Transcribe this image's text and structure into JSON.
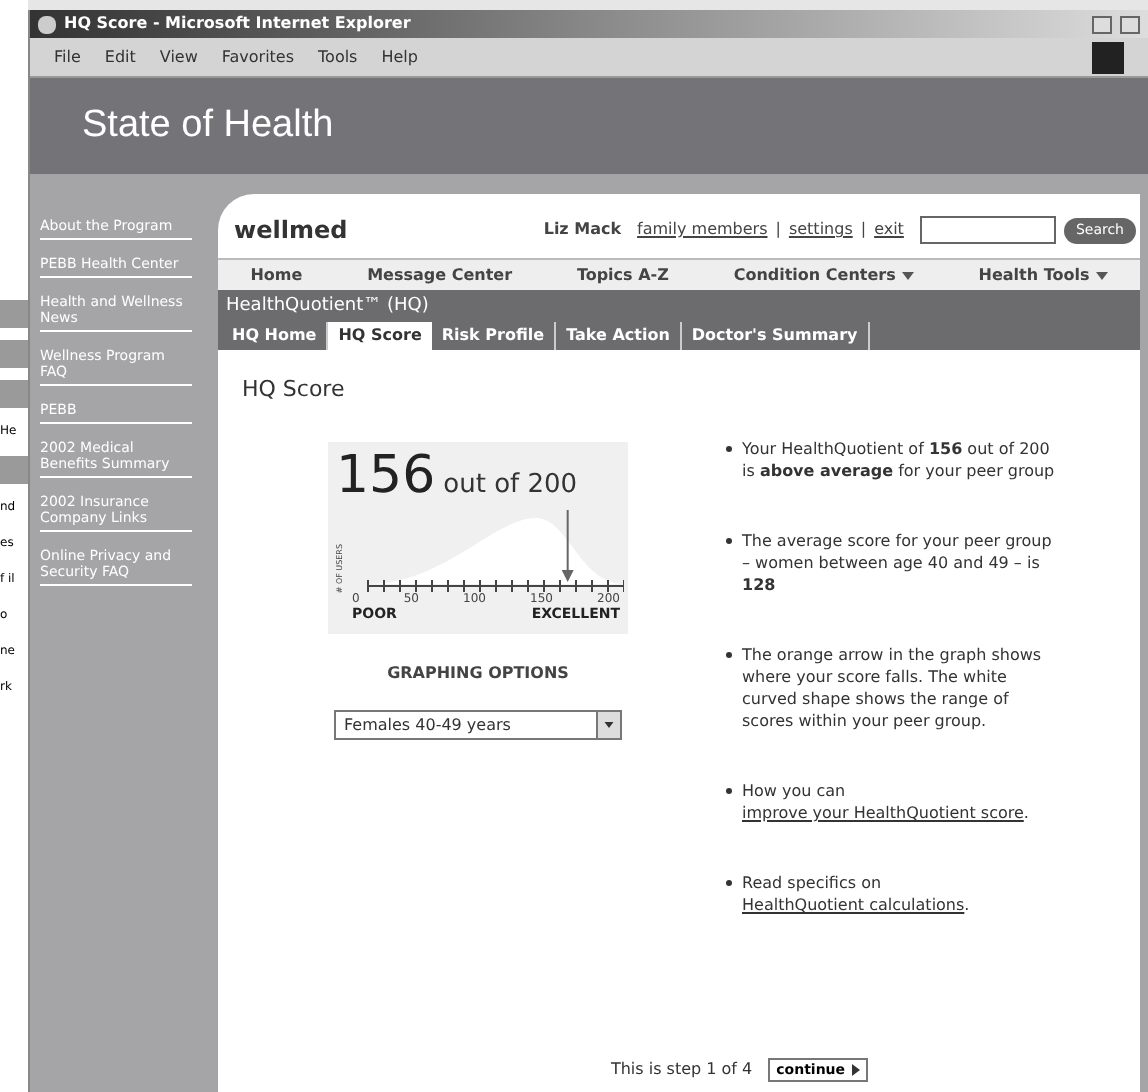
{
  "background_window": {
    "fragments": [
      {
        "kind": "bar"
      },
      {
        "kind": "bar"
      },
      {
        "kind": "bar"
      },
      {
        "kind": "text",
        "text": "He"
      },
      {
        "kind": "bar"
      },
      {
        "kind": "text",
        "text": "nd"
      },
      {
        "kind": "text",
        "text": "es"
      },
      {
        "kind": "text",
        "text": "f il"
      },
      {
        "kind": "text",
        "text": "o"
      },
      {
        "kind": "text",
        "text": "ne"
      },
      {
        "kind": "text",
        "text": "rk"
      }
    ]
  },
  "window": {
    "title": "HQ Score - Microsoft Internet Explorer"
  },
  "menu_bar": [
    "File",
    "Edit",
    "View",
    "Favorites",
    "Tools",
    "Help"
  ],
  "header": {
    "title": "State of Health"
  },
  "sidebar": {
    "items": [
      {
        "label": "About the Program"
      },
      {
        "label": "PEBB Health Center"
      },
      {
        "label": "Health and Wellness News"
      },
      {
        "label": "Wellness Program FAQ"
      },
      {
        "label": "PEBB"
      },
      {
        "label": "2002 Medical Benefits Summary"
      },
      {
        "label": "2002 Insurance Company Links"
      },
      {
        "label": "Online Privacy and Security FAQ"
      }
    ]
  },
  "top_bar": {
    "logo": "wellmed",
    "user": "Liz Mack",
    "links": [
      "family members",
      "settings",
      "exit"
    ],
    "separator": "|",
    "search_button": "Search"
  },
  "nav": [
    {
      "label": "Home",
      "dropdown": false
    },
    {
      "label": "Message Center",
      "dropdown": false
    },
    {
      "label": "Topics A-Z",
      "dropdown": false
    },
    {
      "label": "Condition Centers",
      "dropdown": true
    },
    {
      "label": "Health Tools",
      "dropdown": true
    }
  ],
  "section": {
    "title": "HealthQuotient™ (HQ)"
  },
  "tabs": [
    {
      "label": "HQ Home",
      "selected": false
    },
    {
      "label": "HQ Score",
      "selected": true
    },
    {
      "label": "Risk Profile",
      "selected": false
    },
    {
      "label": "Take Action",
      "selected": false
    },
    {
      "label": "Doctor's Summary",
      "selected": false
    }
  ],
  "page_title": "HQ Score",
  "score": {
    "value": "156",
    "suffix": "out of 200",
    "y_label": "# OF USERS",
    "ticks": [
      "0",
      "50",
      "100",
      "150",
      "200"
    ],
    "low_label": "POOR",
    "high_label": "EXCELLENT",
    "level": 0.78
  },
  "graphing_options": {
    "title": "GRAPHING OPTIONS",
    "value": "Females 40-49 years"
  },
  "bullets": [
    {
      "kind": "text",
      "text": "Your HealthQuotient of **156** out of 200 is **above average** for your peer group"
    },
    {
      "kind": "text",
      "text": "The average score for your peer group – women between age 40 and 49 – is **128**"
    },
    {
      "kind": "text",
      "text": "The orange arrow in the graph shows where your score falls. The white curved shape shows the range of scores within your peer group."
    },
    {
      "kind": "link",
      "before": "How you can ",
      "link": "improve your HealthQuotient score",
      "after": "."
    },
    {
      "kind": "link",
      "before": "Read specifics on ",
      "link": "HealthQuotient calculations",
      "after": "."
    }
  ],
  "footer": {
    "step": "This is step 1 of 4",
    "button": "continue"
  }
}
